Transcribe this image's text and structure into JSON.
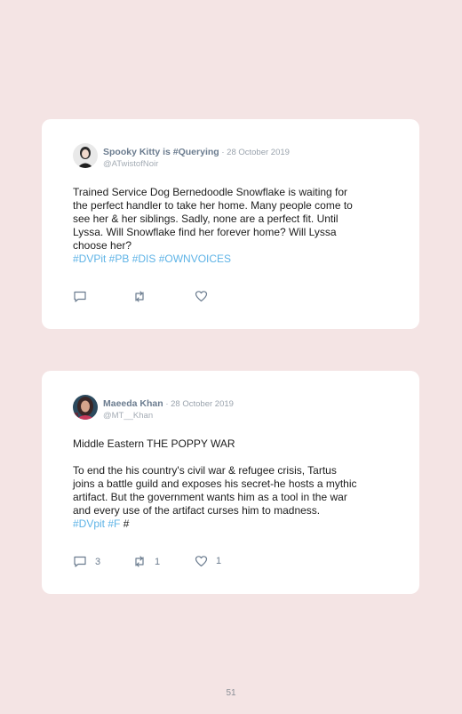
{
  "tweets": [
    {
      "name": "Spooky Kitty is #Querying",
      "separator": " · ",
      "date": "28 October 2019",
      "handle": "@ATwistofNoir",
      "text_lines": [
        "Trained Service Dog Bernedoodle Snowflake is waiting for",
        "the perfect handler to take her home. Many people come to",
        "see her & her siblings. Sadly, none are a perfect fit. Until",
        "Lyssa. Will Snowflake find her forever home? Will Lyssa",
        "choose her?"
      ],
      "hashtags": "#DVPit #PB #DIS #OWNVOICES",
      "icons": {
        "reply": "reply-icon",
        "retweet": "retweet-icon",
        "like": "heart-icon"
      }
    },
    {
      "name": "Maeeda Khan",
      "separator": " · ",
      "date": "28 October 2019",
      "handle": "@MT__Khan",
      "text_lines": [
        "Middle Eastern THE POPPY WAR",
        "",
        "To end the his country's civil war & refugee crisis, Tartus",
        "joins a battle guild and exposes his secret-he hosts a mythic",
        "artifact. But the government wants him as a tool in the war",
        "and every use of the artifact curses him to madness."
      ],
      "hashtags": "#DVpit #F",
      "trailing": " #",
      "counts": {
        "reply": "3",
        "retweet": "1",
        "like": "1"
      },
      "icons": {
        "reply": "reply-icon",
        "retweet": "retweet-icon",
        "like": "heart-icon"
      }
    }
  ],
  "page_number": "51",
  "colors": {
    "background": "#f4e4e4",
    "card": "#ffffff",
    "hashtag": "#5eb3e6",
    "name": "#6b7c8f"
  }
}
